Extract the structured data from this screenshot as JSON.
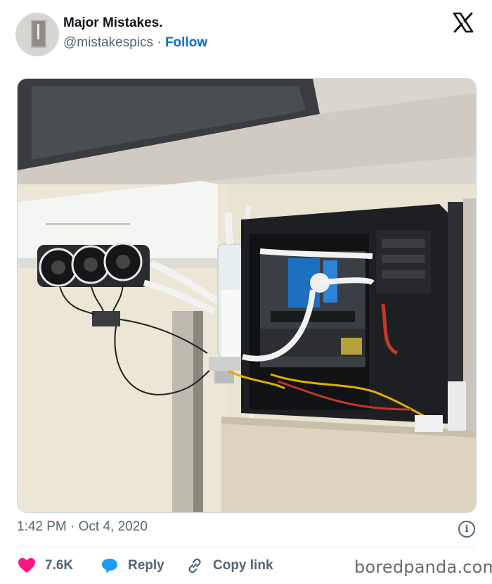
{
  "author": {
    "name": "Major Mistakes.",
    "handle": "@mistakespics",
    "separator": "·",
    "follow_label": "Follow"
  },
  "platform_icon": "x-logo-icon",
  "photo": {
    "alt": "",
    "colors": {
      "ceiling": "#d9d6cf",
      "wall": "#e9e3d2",
      "pc_case": "#1e1f22",
      "tubing": "#f2f2f2",
      "cable_red": "#c0392b",
      "cable_yellow": "#e0b000"
    }
  },
  "meta": {
    "time": "1:42 PM",
    "separator": "·",
    "date": "Oct 4, 2020"
  },
  "actions": {
    "likes_count": "7.6K",
    "reply_label": "Reply",
    "copy_link_label": "Copy link"
  },
  "watermark": "boredpanda.com",
  "colors": {
    "heart": "#f91880",
    "reply_bubble": "#1d9bf0",
    "follow": "#006fd6",
    "muted": "#536471"
  },
  "icons": [
    "info-icon",
    "heart-icon",
    "reply-bubble-icon",
    "link-icon"
  ]
}
